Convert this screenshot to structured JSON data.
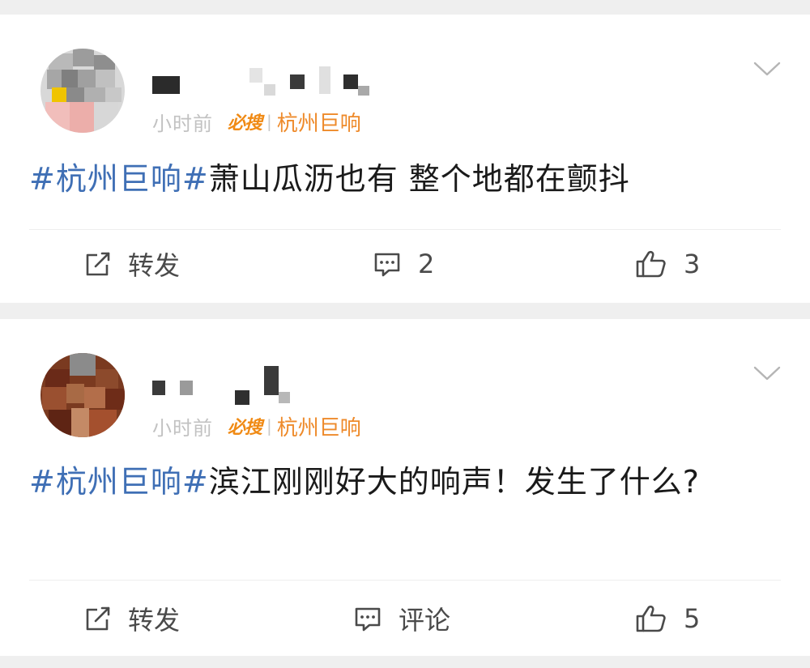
{
  "colors": {
    "hashtag": "#3f6fb5",
    "source_orange": "#f08a14",
    "meta_gray": "#c2c2c2",
    "text": "#1a1a1a",
    "action_text": "#4a4a4a"
  },
  "posts": [
    {
      "time_fragment": "小时前",
      "source_badge": "必搜",
      "separator": "|",
      "source_topic": "杭州巨响",
      "hashtag": "#杭州巨响#",
      "text": "萧山瓜沥也有 整个地都在颤抖",
      "actions": {
        "repost_label": "转发",
        "comment_label": "2",
        "like_count": "3"
      },
      "icons": [
        "more-chevron-icon",
        "repost-icon",
        "comment-icon",
        "like-icon"
      ]
    },
    {
      "time_fragment": "小时前",
      "source_badge": "必搜",
      "separator": "|",
      "source_topic": "杭州巨响",
      "hashtag": "#杭州巨响#",
      "text": "滨江刚刚好大的响声！发生了什么?",
      "actions": {
        "repost_label": "转发",
        "comment_label": "评论",
        "like_count": "5"
      },
      "icons": [
        "more-chevron-icon",
        "repost-icon",
        "comment-icon",
        "like-icon"
      ]
    }
  ]
}
